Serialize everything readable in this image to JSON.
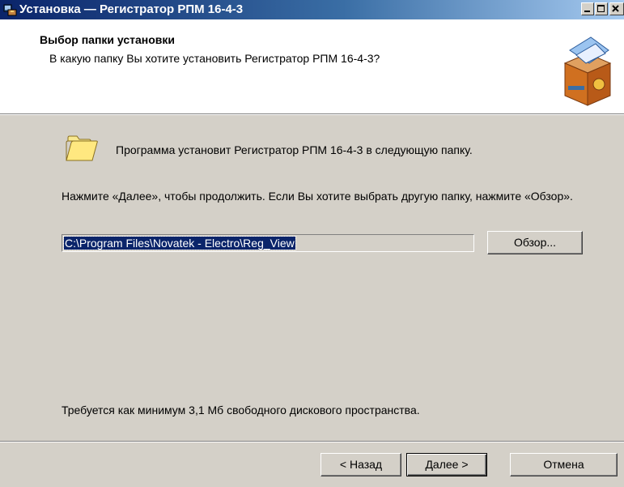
{
  "window": {
    "title": "Установка — Регистратор РПМ 16-4-3",
    "app_icon": "installer-icon",
    "controls": [
      "minimize",
      "maximize",
      "close"
    ]
  },
  "header": {
    "title": "Выбор папки установки",
    "subtitle": "В какую папку Вы хотите установить Регистратор РПМ 16-4-3?",
    "icon": "setup-box-icon"
  },
  "main": {
    "folder_icon": "folder-icon",
    "info_line": "Программа установит Регистратор РПМ 16-4-3 в следующую папку.",
    "instructions": "Нажмите «Далее», чтобы продолжить. Если Вы хотите выбрать другую папку, нажмите «Обзор».",
    "path_value": "C:\\Program Files\\Novatek - Electro\\Reg_View",
    "browse_label": "Обзор...",
    "space_required": "Требуется как минимум 3,1 Мб свободного дискового пространства."
  },
  "footer": {
    "back_label": "< Назад",
    "next_label": "Далее >",
    "cancel_label": "Отмена"
  },
  "colors": {
    "titlebar_start": "#0a246a",
    "titlebar_end": "#a6caf0",
    "dialog_bg": "#d4d0c8",
    "selection": "#0a246a"
  }
}
